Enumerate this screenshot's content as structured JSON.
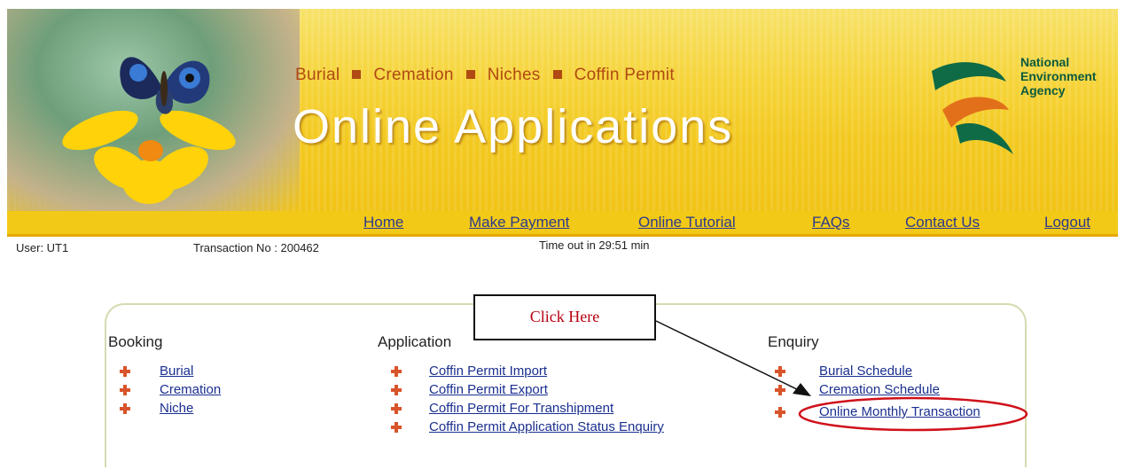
{
  "header": {
    "subnav": [
      "Burial",
      "Cremation",
      "Niches",
      "Coffin Permit"
    ],
    "title": "Online Applications",
    "agency": [
      "National",
      "Environment",
      "Agency"
    ]
  },
  "nav": [
    "Home",
    "Make Payment",
    "Online Tutorial",
    "FAQs",
    "Contact Us",
    "Logout"
  ],
  "session": {
    "user": "User: UT1",
    "transaction": "Transaction No : 200462",
    "timeout": "Time out in 29:51 min"
  },
  "menu": {
    "booking": {
      "title": "Booking",
      "items": [
        "Burial",
        "Cremation",
        "Niche"
      ]
    },
    "application": {
      "title": "Application",
      "items": [
        "Coffin Permit Import",
        "Coffin Permit Export",
        "Coffin Permit For Transhipment",
        "Coffin Permit Application Status Enquiry"
      ]
    },
    "enquiry": {
      "title": "Enquiry",
      "items": [
        "Burial Schedule",
        "Cremation Schedule",
        "Online Monthly Transaction"
      ]
    }
  },
  "annotation": {
    "callout": "Click Here"
  },
  "colors": {
    "banner": "#f3c918",
    "link": "#1a2f8f",
    "annotation": "#d0101a",
    "bullet": "#d9542b"
  }
}
